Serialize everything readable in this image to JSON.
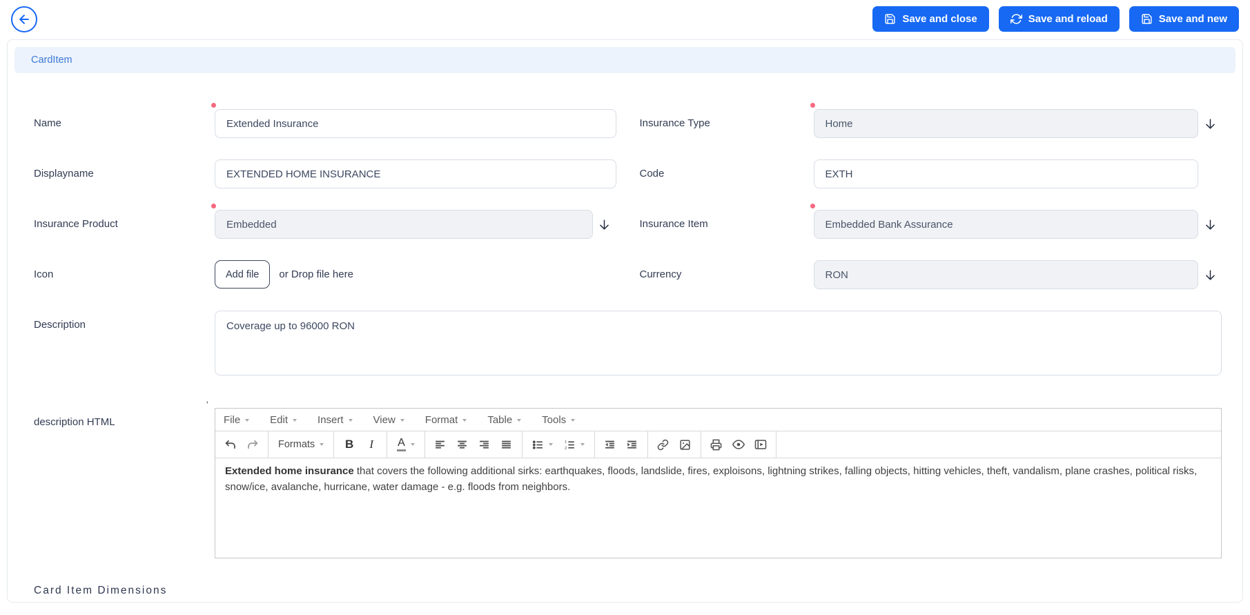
{
  "topbar": {
    "buttons": [
      {
        "label": "Save and close",
        "icon": "save-icon"
      },
      {
        "label": "Save and reload",
        "icon": "reload-icon"
      },
      {
        "label": "Save and new",
        "icon": "save-icon"
      }
    ]
  },
  "panel": {
    "title": "CardItem"
  },
  "fields": {
    "name": {
      "label": "Name",
      "value": "Extended Insurance",
      "required": true
    },
    "insurance_type": {
      "label": "Insurance Type",
      "value": "Home",
      "required": true
    },
    "displayname": {
      "label": "Displayname",
      "value": "EXTENDED HOME INSURANCE"
    },
    "code": {
      "label": "Code",
      "value": "EXTH"
    },
    "insurance_product": {
      "label": "Insurance Product",
      "value": "Embedded",
      "required": true
    },
    "insurance_item": {
      "label": "Insurance Item",
      "value": "Embedded Bank Assurance",
      "required": true
    },
    "icon": {
      "label": "Icon",
      "button": "Add file",
      "hint": "or Drop file here"
    },
    "currency": {
      "label": "Currency",
      "value": "RON"
    },
    "description": {
      "label": "Description",
      "value": "Coverage up to 96000 RON"
    },
    "description_html": {
      "label": "description HTML",
      "marker": "'"
    }
  },
  "editor": {
    "menus": [
      "File",
      "Edit",
      "Insert",
      "View",
      "Format",
      "Table",
      "Tools"
    ],
    "formats": "Formats",
    "bold": "B",
    "italic": "I",
    "forecolor": "A",
    "toolbar_icon_names": [
      "undo",
      "redo",
      "formats",
      "bold",
      "italic",
      "text-color",
      "align-left",
      "align-center",
      "align-right",
      "align-justify",
      "bullet-list",
      "numbered-list",
      "outdent",
      "indent",
      "link",
      "image",
      "print",
      "preview",
      "media"
    ],
    "content": {
      "lead": "Extended home insurance",
      "body": " that covers the following additional sirks: earthquakes, floods, landslide, fires, exploisons, lightning strikes, falling objects, hitting vehicles, theft, vandalism, plane crashes, political risks, snow/ice, avalanche, hurricane, water damage - e.g. floods from neighbors."
    }
  },
  "section": {
    "heading": "Card Item Dimensions"
  },
  "colors": {
    "accent": "#1769f4",
    "required_dot": "#f6697f",
    "header_bg": "#ecf3fc",
    "header_text": "#3e79d6",
    "readonly_bg": "#f0f2f5"
  },
  "icons": {
    "back": "arrow-left-circle",
    "save": "floppy-disk",
    "reload": "refresh-arrows",
    "dropdown": "arrow-down"
  }
}
